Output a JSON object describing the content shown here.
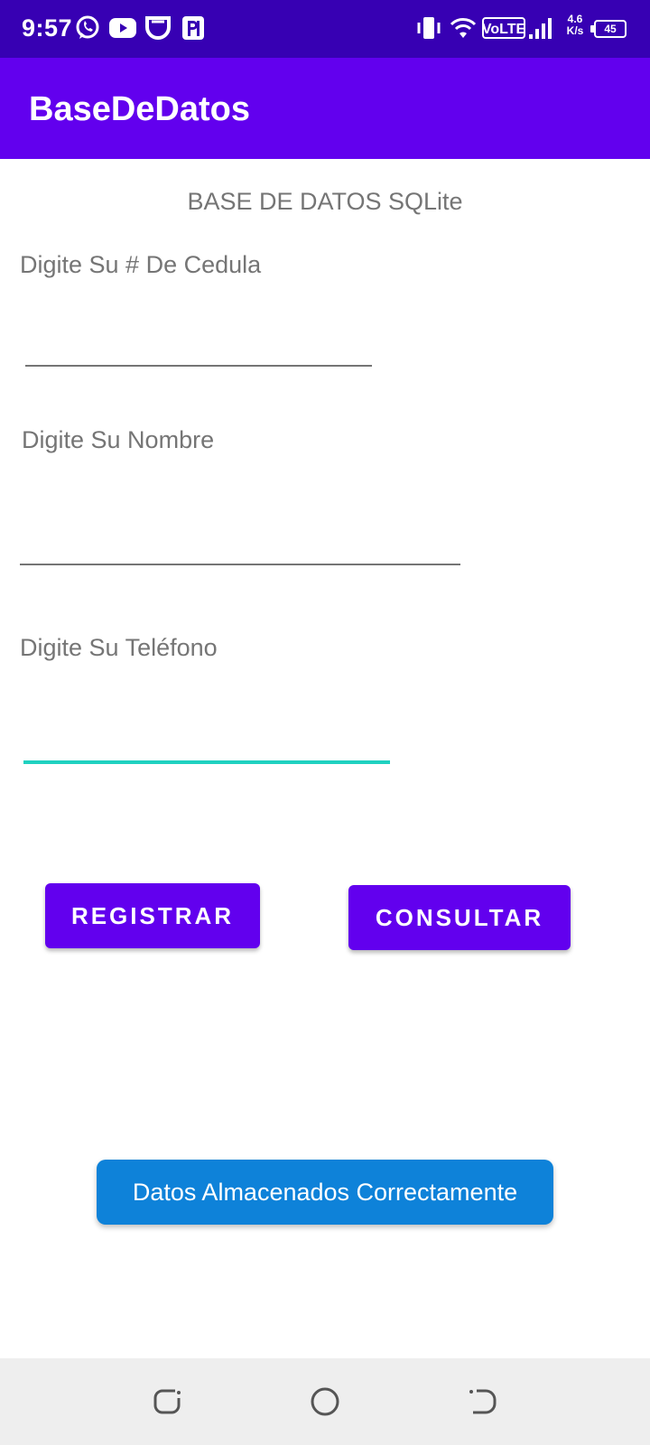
{
  "status_bar": {
    "time": "9:57",
    "net_speed_value": "4.6",
    "net_speed_unit": "K/s",
    "volte": "VoLTE",
    "battery": "45"
  },
  "app_bar": {
    "title": "BaseDeDatos"
  },
  "form": {
    "heading": "BASE DE DATOS SQLite",
    "cedula_label": "Digite Su # De Cedula",
    "cedula_value": "",
    "nombre_label": "Digite Su Nombre",
    "nombre_value": "",
    "telefono_label": "Digite Su Teléfono",
    "telefono_value": ""
  },
  "buttons": {
    "registrar": "REGISTRAR",
    "consultar": "CONSULTAR"
  },
  "toast": {
    "message": "Datos Almacenados Correctamente"
  },
  "colors": {
    "status_bar": "#3700b3",
    "primary": "#6200ee",
    "accent": "#1fd1c0",
    "toast": "#0e82d9"
  }
}
